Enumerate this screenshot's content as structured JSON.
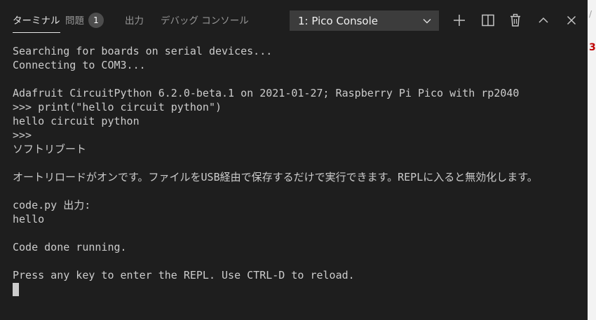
{
  "tabs": [
    {
      "label": "ターミナル",
      "active": true
    },
    {
      "label": "問題",
      "badge": "1"
    },
    {
      "label": "出力"
    },
    {
      "label": "デバッグ コンソール"
    }
  ],
  "console_select": {
    "selected": "1: Pico Console",
    "icon": "chevron-down-icon"
  },
  "toolbar": {
    "icons": [
      "plus-icon",
      "split-icon",
      "trash-icon",
      "chevron-up-icon",
      "close-icon"
    ]
  },
  "terminal": {
    "lines": [
      "Searching for boards on serial devices...",
      "Connecting to COM3...",
      "",
      "Adafruit CircuitPython 6.2.0-beta.1 on 2021-01-27; Raspberry Pi Pico with rp2040",
      ">>> print(\"hello circuit python\")",
      "hello circuit python",
      ">>>",
      "ソフトリブート",
      "",
      "オートリロードがオンです。ファイルをUSB経由で保存するだけで実行できます。REPLに入ると無効化します。",
      "",
      "code.py 出力:",
      "hello",
      "",
      "Code done running.",
      "",
      "Press any key to enter the REPL. Use CTRL-D to reload."
    ]
  },
  "colors": {
    "background": "#1e1e1e",
    "tab_active": "#e7e7e7",
    "tab_inactive": "#969696",
    "text": "#cccccc",
    "select_bg": "#3c3c3c",
    "badge_bg": "#4d4d4d"
  }
}
